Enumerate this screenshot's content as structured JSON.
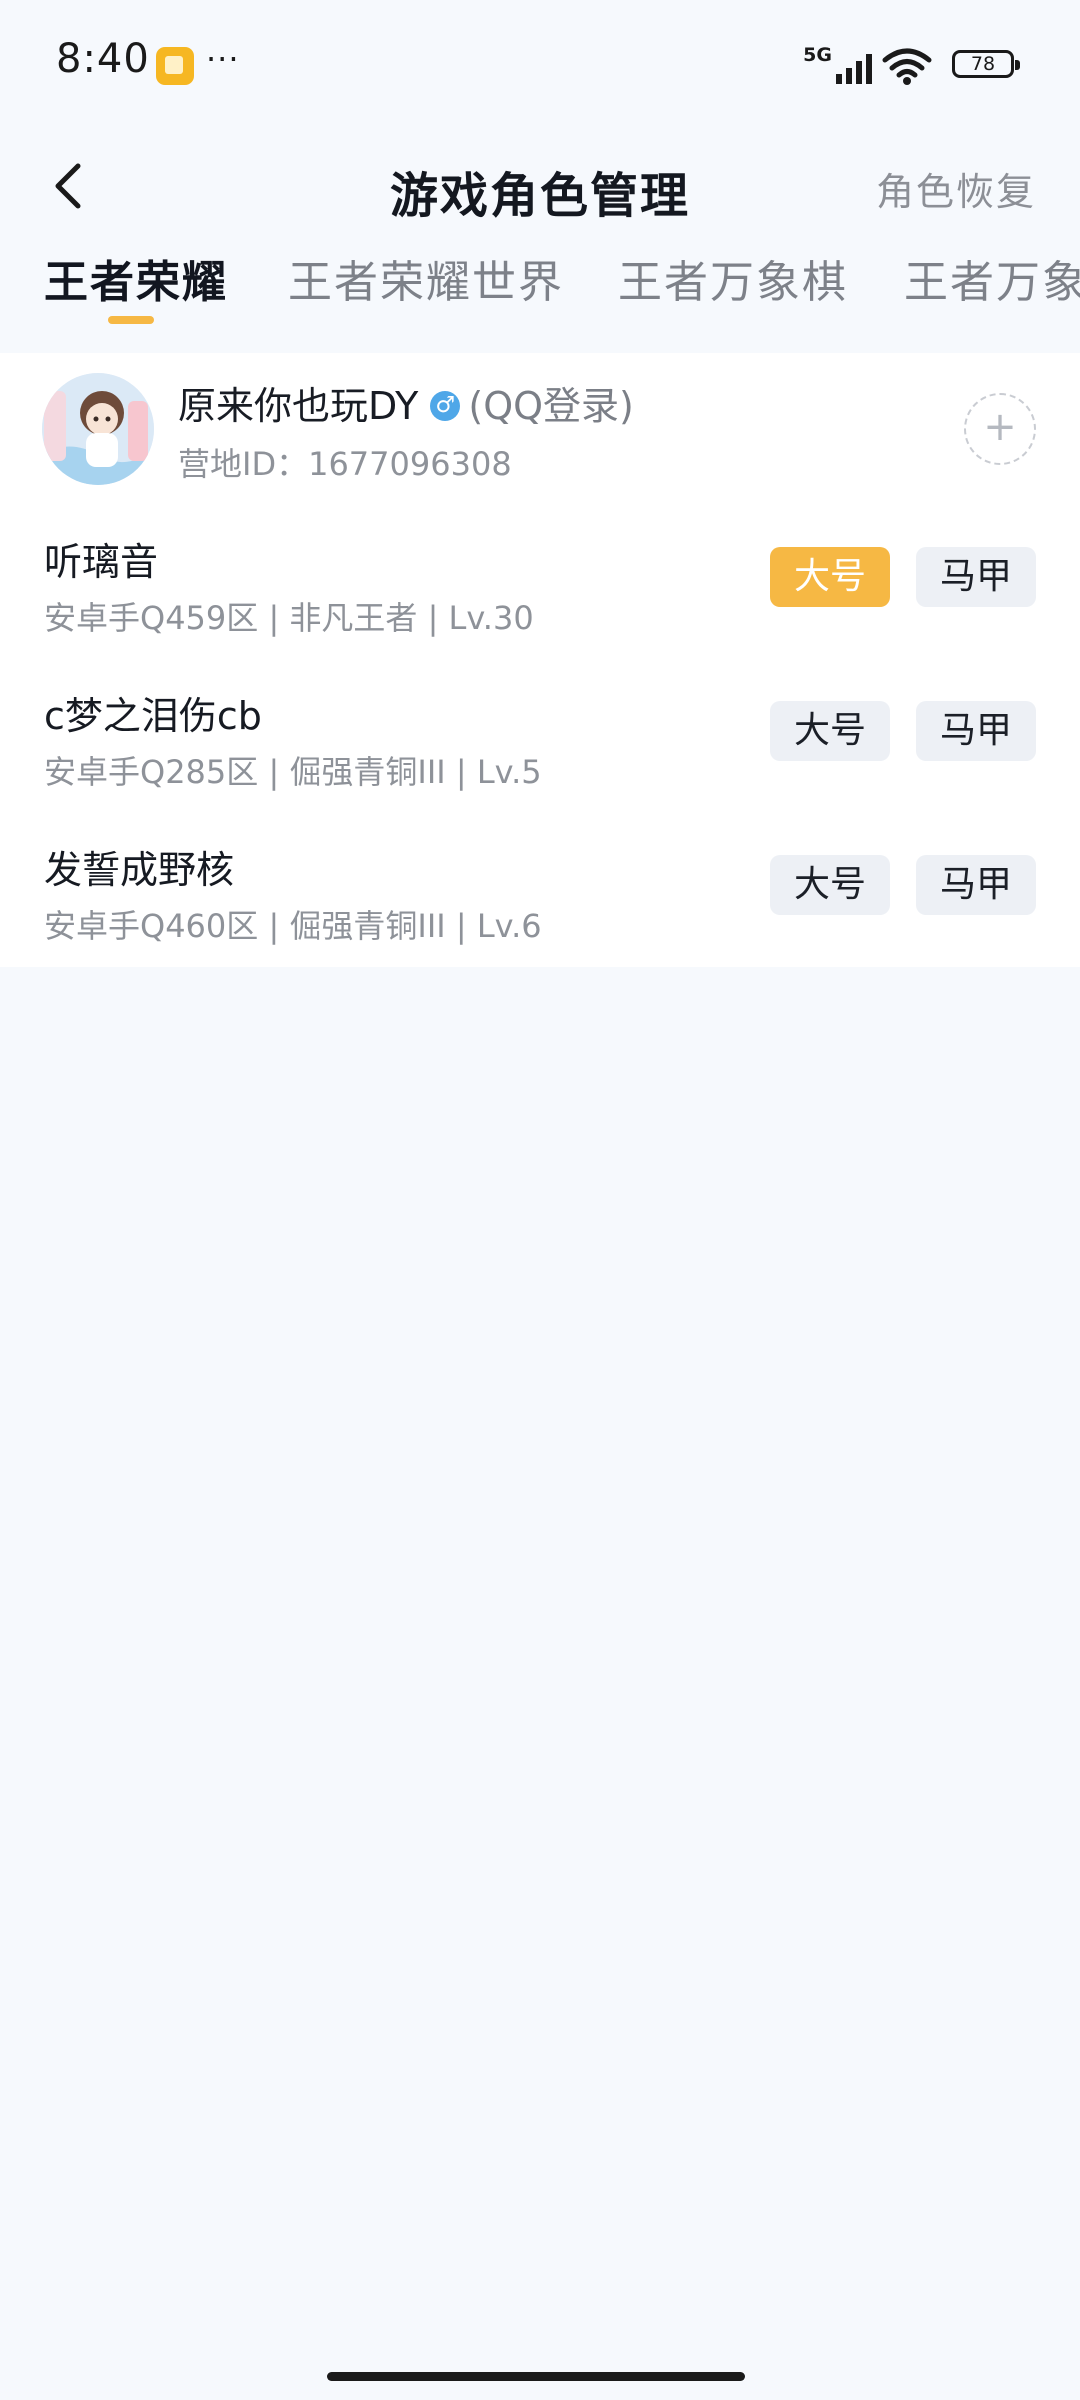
{
  "status_bar": {
    "time": "8:40",
    "more": "···",
    "network": "5G",
    "battery": "78"
  },
  "header": {
    "title": "游戏角色管理",
    "right_action": "角色恢复"
  },
  "tabs": [
    {
      "label": "王者荣耀",
      "active": true
    },
    {
      "label": "王者荣耀世界",
      "active": false
    },
    {
      "label": "王者万象棋",
      "active": false
    },
    {
      "label": "王者万象",
      "active": false
    }
  ],
  "account": {
    "name": "原来你也玩DY",
    "login_type": "(QQ登录)",
    "id_text": "营地ID：1677096308",
    "add_icon": "+"
  },
  "roles": [
    {
      "name": "听璃音",
      "meta": "安卓手Q459区 | 非凡王者 | Lv.30",
      "main_label": "大号",
      "alt_label": "马甲",
      "selected": "main"
    },
    {
      "name": "c梦之泪伤cb",
      "meta": "安卓手Q285区 | 倔强青铜III | Lv.5",
      "main_label": "大号",
      "alt_label": "马甲",
      "selected": "none"
    },
    {
      "name": "发誓成野核",
      "meta": "安卓手Q460区 | 倔强青铜III | Lv.6",
      "main_label": "大号",
      "alt_label": "马甲",
      "selected": "none"
    }
  ],
  "colors": {
    "accent": "#f6b844",
    "background": "#f6f9fd",
    "tag_bg": "#edf0f5"
  },
  "icons": {
    "back": "chevron-left-icon",
    "gender": "male-icon",
    "add": "plus-icon",
    "signal": "signal-icon",
    "wifi": "wifi-icon",
    "battery": "battery-icon"
  }
}
